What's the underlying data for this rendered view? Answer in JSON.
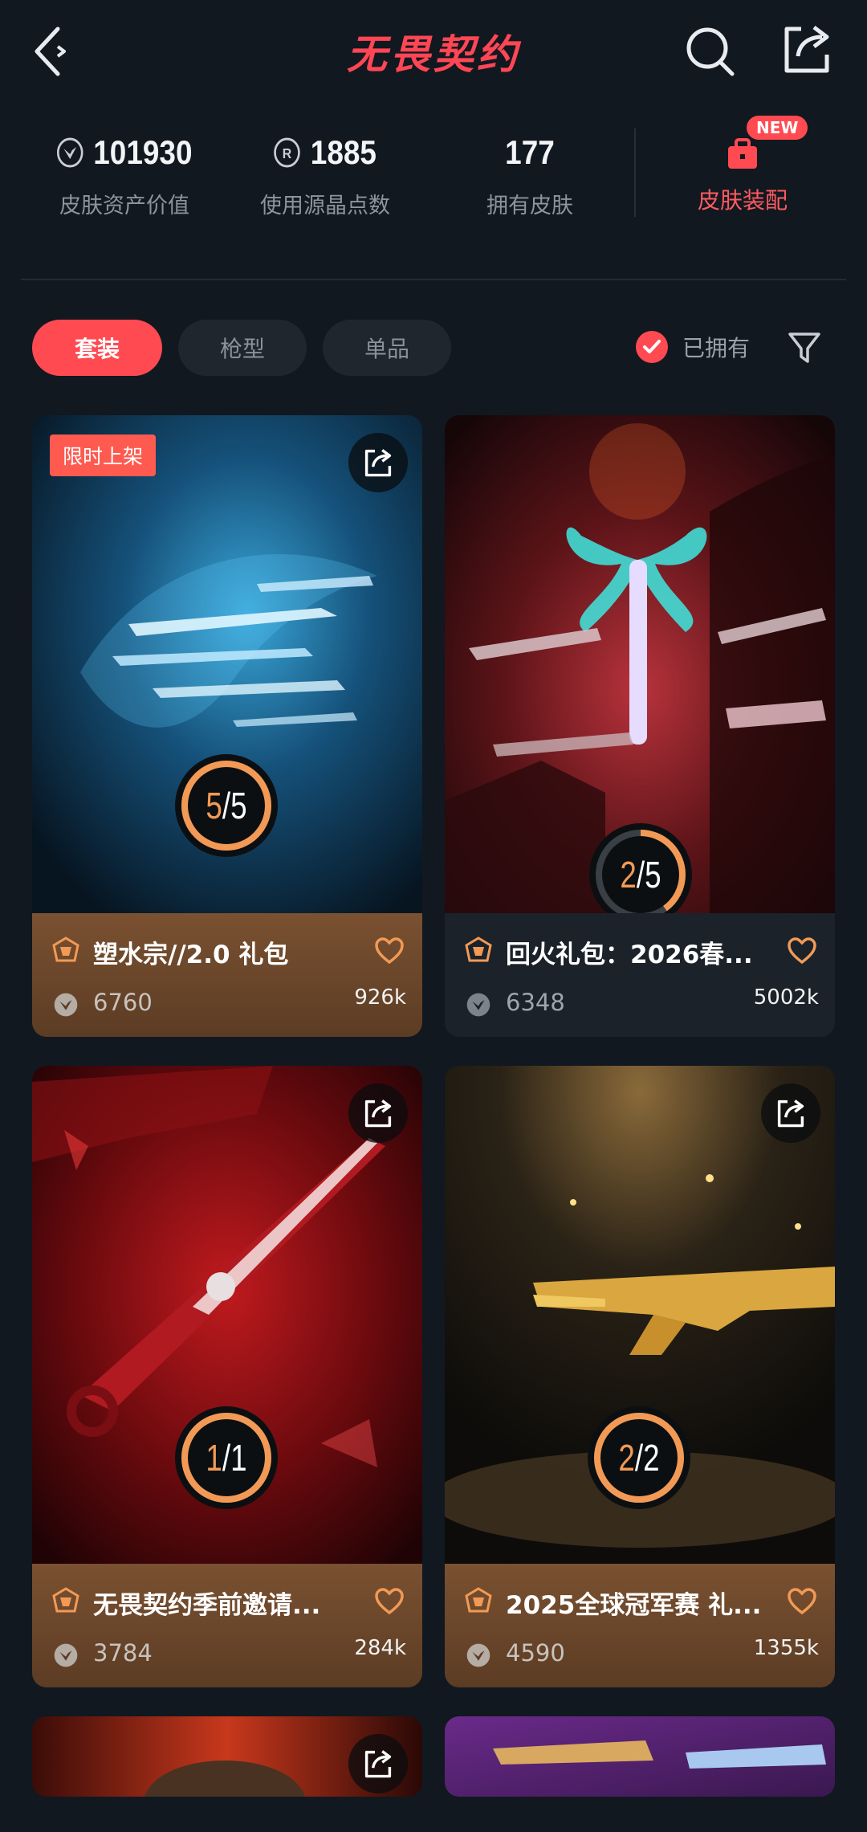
{
  "header": {
    "title": "无畏契约"
  },
  "stats": [
    {
      "value": "101930",
      "label": "皮肤资产价值",
      "currency": "vp-icon"
    },
    {
      "value": "1885",
      "label": "使用源晶点数",
      "currency": "radianite-icon"
    },
    {
      "value": "177",
      "label": "拥有皮肤",
      "currency": ""
    }
  ],
  "equip": {
    "label": "皮肤装配",
    "badge": "NEW"
  },
  "tabs": [
    {
      "label": "套装"
    },
    {
      "label": "枪型"
    },
    {
      "label": "单品"
    }
  ],
  "owned_filter": {
    "label": "已拥有",
    "checked": true
  },
  "cards": [
    {
      "title": "塑水宗//2.0 礼包",
      "price": "6760",
      "likes": "926k",
      "owned": "5",
      "total": "5",
      "badge": "限时上架",
      "footer": "brown"
    },
    {
      "title": "回火礼包：2026春...",
      "price": "6348",
      "likes": "5002k",
      "owned": "2",
      "total": "5",
      "badge": "",
      "footer": "dark"
    },
    {
      "title": "无畏契约季前邀请...",
      "price": "3784",
      "likes": "284k",
      "owned": "1",
      "total": "1",
      "badge": "",
      "footer": "brown"
    },
    {
      "title": "2025全球冠军赛 礼...",
      "price": "4590",
      "likes": "1355k",
      "owned": "2",
      "total": "2",
      "badge": "",
      "footer": "brown"
    }
  ],
  "colors": {
    "accent": "#ff4a52",
    "progress": "#f29a55",
    "background": "#111820"
  }
}
